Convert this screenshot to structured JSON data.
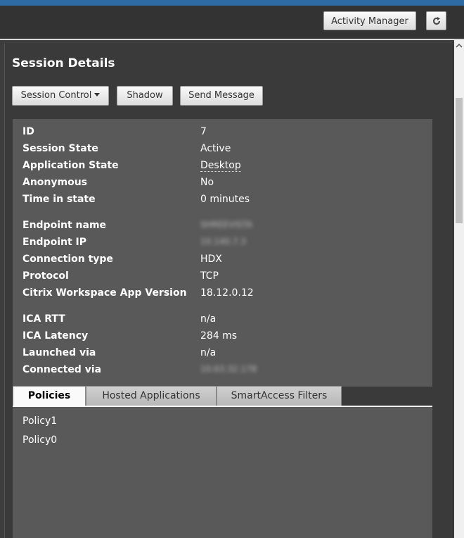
{
  "header": {
    "activity_manager_label": "Activity Manager",
    "refresh_icon": "refresh-icon"
  },
  "session": {
    "title": "Session Details",
    "actions": {
      "session_control": "Session Control",
      "shadow": "Shadow",
      "send_message": "Send Message"
    },
    "details": [
      {
        "label": "ID",
        "value": "7"
      },
      {
        "label": "Session State",
        "value": "Active"
      },
      {
        "label": "Application State",
        "value": "Desktop"
      },
      {
        "label": "Anonymous",
        "value": "No"
      },
      {
        "label": "Time in state",
        "value": "0 minutes"
      },
      {
        "label": "Endpoint name",
        "value": "SHREEVISTA"
      },
      {
        "label": "Endpoint IP",
        "value": "10.140.7.3"
      },
      {
        "label": "Connection type",
        "value": "HDX"
      },
      {
        "label": "Protocol",
        "value": "TCP"
      },
      {
        "label": "Citrix Workspace App Version",
        "value": "18.12.0.12"
      },
      {
        "label": "ICA RTT",
        "value": "n/a"
      },
      {
        "label": "ICA Latency",
        "value": "284 ms"
      },
      {
        "label": "Launched via",
        "value": "n/a"
      },
      {
        "label": "Connected via",
        "value": "10.63.32.178"
      }
    ]
  },
  "tabs": [
    {
      "label": "Policies",
      "active": true
    },
    {
      "label": "Hosted Applications",
      "active": false
    },
    {
      "label": "SmartAccess Filters",
      "active": false
    }
  ],
  "policies": [
    "Policy1",
    "Policy0"
  ]
}
